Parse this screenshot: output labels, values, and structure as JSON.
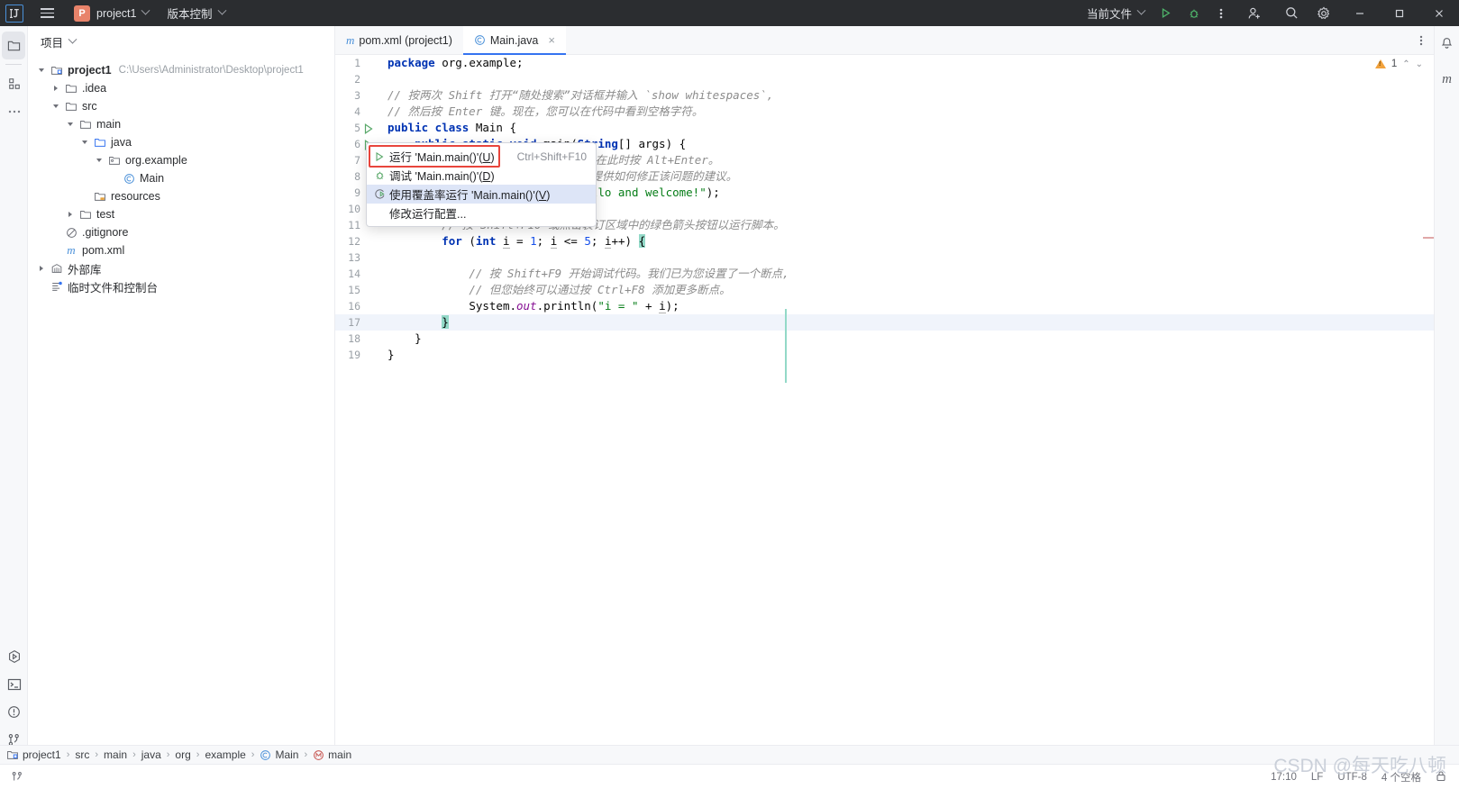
{
  "titlebar": {
    "logo": "IJ",
    "menu_icon": "hamburger-icon",
    "project_badge": "P",
    "project_name": "project1",
    "vcs_label": "版本控制",
    "run_config": "当前文件",
    "run_icon": "run-triangle-icon",
    "debug_icon": "debug-bug-icon",
    "more_icon": "more-vertical-icon",
    "account_icon": "add-user-icon",
    "search_icon": "search-icon",
    "settings_icon": "gear-icon",
    "minimize_icon": "minimize-icon",
    "maximize_icon": "maximize-icon",
    "close_icon": "close-icon"
  },
  "left_strip": {
    "top_items": [
      {
        "name": "project-tool-icon",
        "active": true
      },
      {
        "name": "structure-tool-icon",
        "active": false
      },
      {
        "name": "more-tools-icon",
        "active": false
      }
    ],
    "bottom_items": [
      {
        "name": "run-tool-icon"
      },
      {
        "name": "terminal-tool-icon"
      },
      {
        "name": "problems-tool-icon"
      },
      {
        "name": "git-tool-icon"
      }
    ]
  },
  "project_panel": {
    "title": "项目",
    "tree": [
      {
        "indent": 0,
        "twist": "open",
        "icon": "module-icon",
        "label": "project1",
        "bold": true,
        "path": "C:\\Users\\Administrator\\Desktop\\project1"
      },
      {
        "indent": 1,
        "twist": "closed",
        "icon": "folder-icon",
        "label": ".idea",
        "bold": false,
        "path": ""
      },
      {
        "indent": 1,
        "twist": "open",
        "icon": "folder-icon",
        "label": "src",
        "bold": false,
        "path": ""
      },
      {
        "indent": 2,
        "twist": "open",
        "icon": "folder-icon",
        "label": "main",
        "bold": false,
        "path": ""
      },
      {
        "indent": 3,
        "twist": "open",
        "icon": "source-folder-icon",
        "label": "java",
        "bold": false,
        "path": ""
      },
      {
        "indent": 4,
        "twist": "open",
        "icon": "package-icon",
        "label": "org.example",
        "bold": false,
        "path": ""
      },
      {
        "indent": 5,
        "twist": "none",
        "icon": "java-class-icon",
        "label": "Main",
        "bold": false,
        "path": ""
      },
      {
        "indent": 3,
        "twist": "none",
        "icon": "resources-folder-icon",
        "label": "resources",
        "bold": false,
        "path": ""
      },
      {
        "indent": 2,
        "twist": "closed",
        "icon": "folder-icon",
        "label": "test",
        "bold": false,
        "path": ""
      },
      {
        "indent": 1,
        "twist": "none",
        "icon": "gitignore-icon",
        "label": ".gitignore",
        "bold": false,
        "path": ""
      },
      {
        "indent": 1,
        "twist": "none",
        "icon": "maven-icon",
        "label": "pom.xml",
        "bold": false,
        "path": ""
      },
      {
        "indent": 0,
        "twist": "closed",
        "icon": "library-icon",
        "label": "外部库",
        "bold": false,
        "path": ""
      },
      {
        "indent": 0,
        "twist": "none",
        "icon": "scratches-icon",
        "label": "临时文件和控制台",
        "bold": false,
        "path": ""
      }
    ]
  },
  "tabs": [
    {
      "icon": "maven-icon",
      "label": "pom.xml (project1)",
      "active": false,
      "closable": false
    },
    {
      "icon": "java-class-icon",
      "label": "Main.java",
      "active": true,
      "closable": true
    }
  ],
  "editor": {
    "inspection_count": "1",
    "inspection_icon": "warning-triangle-icon",
    "up_icon": "chevron-up-icon",
    "down_icon": "chevron-down-icon",
    "more_icon": "more-vertical-icon",
    "lines": [
      {
        "n": "1",
        "html": "<span class='kw'>package</span> <span class='plain'>org.example;</span>"
      },
      {
        "n": "2",
        "html": ""
      },
      {
        "n": "3",
        "html": "<span class='cmt'>// 按两次 Shift 打开“随处搜索”对话框并输入 `show whitespaces`,</span>"
      },
      {
        "n": "4",
        "html": "<span class='cmt'>// 然后按 Enter 键。现在，您可以在代码中看到空格字符。</span>"
      },
      {
        "n": "5",
        "html": "<span class='kw'>public class</span> <span class='plain'>Main {</span>",
        "gutter": "run-arrow"
      },
      {
        "n": "6",
        "html": "    <span class='kw'>public static void</span> <span class='plain'>main(</span><span class='kw'>String</span><span class='plain'>[] args) {</span>",
        "gutter": "run-arrow"
      },
      {
        "n": "7",
        "html": "        <span class='cmt'>// 按 Ctrl+D 复制此行，或在此时按 Alt+Enter。</span>"
      },
      {
        "n": "8",
        "html": "        <span class='cmt'>// IntelliJ IDEA 会向您提供如何修正该问题的建议。</span>"
      },
      {
        "n": "9",
        "html": "        <span class='plain'>System.</span><span class='fld'>out</span><span class='plain'>.println(</span><span class='str'>\"Hello and welcome!\"</span><span class='plain'>);</span>"
      },
      {
        "n": "10",
        "html": ""
      },
      {
        "n": "11",
        "html": "        <span class='cmt'>// 按 Shift+F10 或点击装订区域中的绿色箭头按钮以运行脚本。</span>"
      },
      {
        "n": "12",
        "html": "        <span class='kw'>for</span> <span class='plain'>(</span><span class='kw'>int</span> <span class='varu'>i</span> <span class='plain'>=</span> <span class='num'>1</span><span class='plain'>;</span> <span class='varu'>i</span> <span class='plain'>&lt;=</span> <span class='num'>5</span><span class='plain'>;</span> <span class='varu'>i</span><span class='plain'>++)</span> <span class='brmatch'>{</span>"
      },
      {
        "n": "13",
        "html": ""
      },
      {
        "n": "14",
        "html": "            <span class='cmt'>// 按 Shift+F9 开始调试代码。我们已为您设置了一个断点,</span>"
      },
      {
        "n": "15",
        "html": "            <span class='cmt'>// 但您始终可以通过按 Ctrl+F8 添加更多断点。</span>"
      },
      {
        "n": "16",
        "html": "            <span class='plain'>System.</span><span class='fld'>out</span><span class='plain'>.println(</span><span class='str'>\"i = \"</span> <span class='plain'>+</span> <span class='varu'>i</span><span class='plain'>);</span>"
      },
      {
        "n": "17",
        "html": "        <span class='brmatch'>}</span>",
        "current": true
      },
      {
        "n": "18",
        "html": "    <span class='plain'>}</span>"
      },
      {
        "n": "19",
        "html": "<span class='plain'>}</span>"
      }
    ]
  },
  "context_menu": {
    "items": [
      {
        "icon": "run-triangle-icon",
        "label_pre": "运行 'Main.main()'(",
        "mnemonic": "U",
        "label_post": ")",
        "shortcut": "Ctrl+Shift+F10",
        "highlighted": false,
        "boxed": true
      },
      {
        "icon": "debug-bug-icon",
        "label_pre": "调试 'Main.main()'(",
        "mnemonic": "D",
        "label_post": ")",
        "shortcut": "",
        "highlighted": false,
        "boxed": false
      },
      {
        "icon": "coverage-icon",
        "label_pre": "使用覆盖率运行 'Main.main()'(",
        "mnemonic": "V",
        "label_post": ")",
        "shortcut": "",
        "highlighted": true,
        "boxed": false
      },
      {
        "icon": "none",
        "label_pre": "修改运行配置...",
        "mnemonic": "",
        "label_post": "",
        "shortcut": "",
        "highlighted": false,
        "boxed": false
      }
    ]
  },
  "right_strip": {
    "items": [
      {
        "name": "notifications-bell-icon"
      },
      {
        "name": "maven-tool-icon"
      }
    ]
  },
  "breadcrumb": {
    "items": [
      {
        "icon": "module-icon",
        "label": "project1"
      },
      {
        "icon": "none",
        "label": "src"
      },
      {
        "icon": "none",
        "label": "main"
      },
      {
        "icon": "none",
        "label": "java"
      },
      {
        "icon": "none",
        "label": "org"
      },
      {
        "icon": "none",
        "label": "example"
      },
      {
        "icon": "java-class-icon",
        "label": "Main"
      },
      {
        "icon": "java-method-icon",
        "label": "main"
      }
    ],
    "separator": "›"
  },
  "statusbar": {
    "git_icon": "git-branch-icon",
    "position": "17:10",
    "line_separator": "LF",
    "encoding": "UTF-8",
    "indent": "4 个空格",
    "lock_icon": "lock-icon"
  },
  "watermark": "CSDN @每天吃八顿",
  "colors": {
    "titlebar_bg": "#2b2d30",
    "accent": "#3574f0",
    "run_green": "#59a869",
    "warning": "#f2a23c",
    "highlight_red": "#e8453c",
    "menu_highlight": "#dde5f7"
  }
}
